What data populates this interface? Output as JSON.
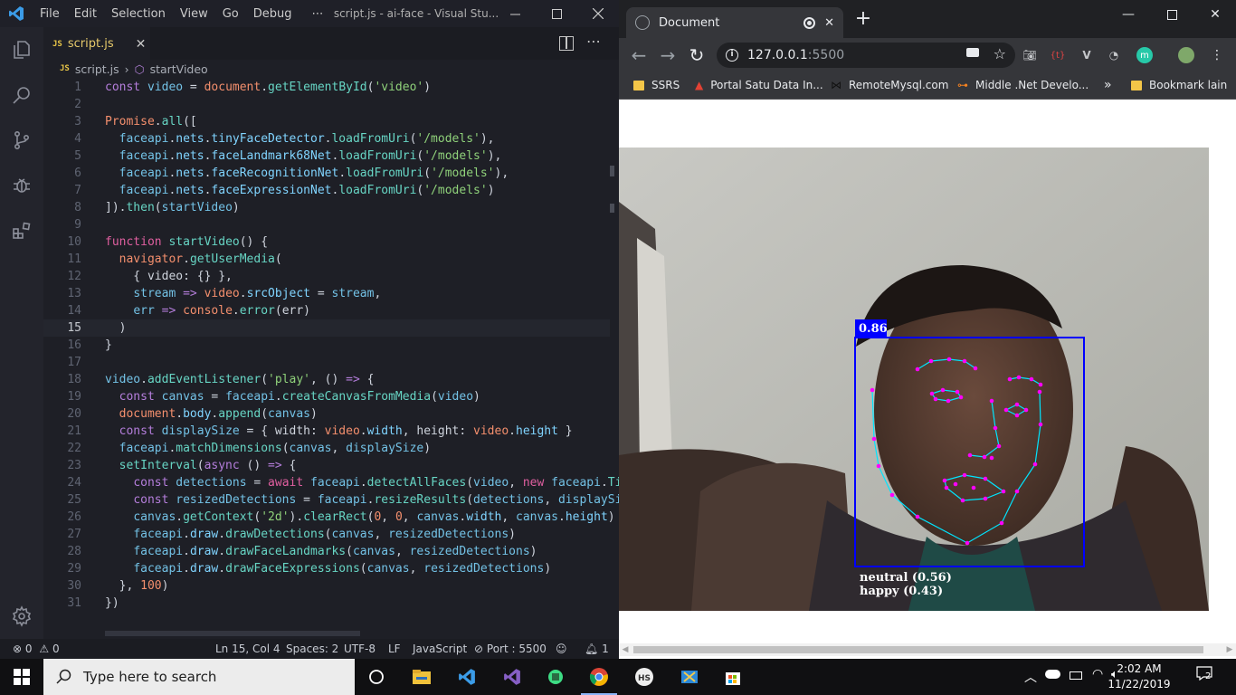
{
  "vscode": {
    "menu": [
      "File",
      "Edit",
      "Selection",
      "View",
      "Go",
      "Debug",
      "⋯"
    ],
    "window_title": "script.js - ai-face - Visual Stu...",
    "tab_label": "script.js",
    "tab_badge": "JS",
    "breadcrumb_file": "script.js",
    "breadcrumb_symbol": "startVideo",
    "current_line": 15,
    "status": {
      "problems_errors": "0",
      "problems_warnings": "0",
      "position": "Ln 15, Col 4",
      "spaces": "Spaces: 2",
      "encoding": "UTF-8",
      "eol": "LF",
      "language": "JavaScript",
      "port": "Port : 5500",
      "notifications": "1"
    }
  },
  "code_lines": [
    [
      [
        "kw2",
        "const "
      ],
      [
        "var",
        "video"
      ],
      [
        "txt",
        " = "
      ],
      [
        "lit",
        "document"
      ],
      [
        "txt",
        "."
      ],
      [
        "vfn",
        "getElementById"
      ],
      [
        "txt",
        "("
      ],
      [
        "str",
        "'video'"
      ],
      [
        "txt",
        ")"
      ]
    ],
    [],
    [
      [
        "lit",
        "Promise"
      ],
      [
        "txt",
        "."
      ],
      [
        "vfn",
        "all"
      ],
      [
        "txt",
        "(["
      ]
    ],
    [
      [
        "txt",
        "  "
      ],
      [
        "var",
        "faceapi"
      ],
      [
        "txt",
        "."
      ],
      [
        "prop",
        "nets"
      ],
      [
        "txt",
        "."
      ],
      [
        "prop",
        "tinyFaceDetector"
      ],
      [
        "txt",
        "."
      ],
      [
        "vfn",
        "loadFromUri"
      ],
      [
        "txt",
        "("
      ],
      [
        "str",
        "'/models'"
      ],
      [
        "txt",
        "),"
      ]
    ],
    [
      [
        "txt",
        "  "
      ],
      [
        "var",
        "faceapi"
      ],
      [
        "txt",
        "."
      ],
      [
        "prop",
        "nets"
      ],
      [
        "txt",
        "."
      ],
      [
        "prop",
        "faceLandmark68Net"
      ],
      [
        "txt",
        "."
      ],
      [
        "vfn",
        "loadFromUri"
      ],
      [
        "txt",
        "("
      ],
      [
        "str",
        "'/models'"
      ],
      [
        "txt",
        "),"
      ]
    ],
    [
      [
        "txt",
        "  "
      ],
      [
        "var",
        "faceapi"
      ],
      [
        "txt",
        "."
      ],
      [
        "prop",
        "nets"
      ],
      [
        "txt",
        "."
      ],
      [
        "prop",
        "faceRecognitionNet"
      ],
      [
        "txt",
        "."
      ],
      [
        "vfn",
        "loadFromUri"
      ],
      [
        "txt",
        "("
      ],
      [
        "str",
        "'/models'"
      ],
      [
        "txt",
        "),"
      ]
    ],
    [
      [
        "txt",
        "  "
      ],
      [
        "var",
        "faceapi"
      ],
      [
        "txt",
        "."
      ],
      [
        "prop",
        "nets"
      ],
      [
        "txt",
        "."
      ],
      [
        "prop",
        "faceExpressionNet"
      ],
      [
        "txt",
        "."
      ],
      [
        "vfn",
        "loadFromUri"
      ],
      [
        "txt",
        "("
      ],
      [
        "str",
        "'/models'"
      ],
      [
        "txt",
        ")"
      ]
    ],
    [
      [
        "txt",
        "])."
      ],
      [
        "vfn",
        "then"
      ],
      [
        "txt",
        "("
      ],
      [
        "var",
        "startVideo"
      ],
      [
        "txt",
        ")"
      ]
    ],
    [],
    [
      [
        "kw",
        "function "
      ],
      [
        "vfn",
        "startVideo"
      ],
      [
        "txt",
        "() {"
      ]
    ],
    [
      [
        "txt",
        "  "
      ],
      [
        "lit",
        "navigator"
      ],
      [
        "txt",
        "."
      ],
      [
        "vfn",
        "getUserMedia"
      ],
      [
        "txt",
        "("
      ]
    ],
    [
      [
        "txt",
        "    { video: {} },"
      ]
    ],
    [
      [
        "txt",
        "    "
      ],
      [
        "var",
        "stream"
      ],
      [
        "txt",
        " "
      ],
      [
        "kw2",
        "=>"
      ],
      [
        "txt",
        " "
      ],
      [
        "lit",
        "video"
      ],
      [
        "txt",
        "."
      ],
      [
        "prop",
        "srcObject"
      ],
      [
        "txt",
        " = "
      ],
      [
        "var",
        "stream"
      ],
      [
        "txt",
        ","
      ]
    ],
    [
      [
        "txt",
        "    "
      ],
      [
        "var",
        "err"
      ],
      [
        "txt",
        " "
      ],
      [
        "kw2",
        "=>"
      ],
      [
        "txt",
        " "
      ],
      [
        "lit",
        "console"
      ],
      [
        "txt",
        "."
      ],
      [
        "vfn",
        "error"
      ],
      [
        "txt",
        "(err)"
      ]
    ],
    [
      [
        "txt",
        "  )"
      ]
    ],
    [
      [
        "txt",
        "}"
      ]
    ],
    [],
    [
      [
        "var",
        "video"
      ],
      [
        "txt",
        "."
      ],
      [
        "vfn",
        "addEventListener"
      ],
      [
        "txt",
        "("
      ],
      [
        "str",
        "'play'"
      ],
      [
        "txt",
        ", () "
      ],
      [
        "kw2",
        "=>"
      ],
      [
        "txt",
        " {"
      ]
    ],
    [
      [
        "txt",
        "  "
      ],
      [
        "kw2",
        "const "
      ],
      [
        "var",
        "canvas"
      ],
      [
        "txt",
        " = "
      ],
      [
        "var",
        "faceapi"
      ],
      [
        "txt",
        "."
      ],
      [
        "vfn",
        "createCanvasFromMedia"
      ],
      [
        "txt",
        "("
      ],
      [
        "var",
        "video"
      ],
      [
        "txt",
        ")"
      ]
    ],
    [
      [
        "txt",
        "  "
      ],
      [
        "lit",
        "document"
      ],
      [
        "txt",
        "."
      ],
      [
        "prop",
        "body"
      ],
      [
        "txt",
        "."
      ],
      [
        "vfn",
        "append"
      ],
      [
        "txt",
        "("
      ],
      [
        "var",
        "canvas"
      ],
      [
        "txt",
        ")"
      ]
    ],
    [
      [
        "txt",
        "  "
      ],
      [
        "kw2",
        "const "
      ],
      [
        "var",
        "displaySize"
      ],
      [
        "txt",
        " = { width: "
      ],
      [
        "lit",
        "video"
      ],
      [
        "txt",
        "."
      ],
      [
        "prop",
        "width"
      ],
      [
        "txt",
        ", height: "
      ],
      [
        "lit",
        "video"
      ],
      [
        "txt",
        "."
      ],
      [
        "prop",
        "height"
      ],
      [
        "txt",
        " }"
      ]
    ],
    [
      [
        "txt",
        "  "
      ],
      [
        "var",
        "faceapi"
      ],
      [
        "txt",
        "."
      ],
      [
        "vfn",
        "matchDimensions"
      ],
      [
        "txt",
        "("
      ],
      [
        "var",
        "canvas"
      ],
      [
        "txt",
        ", "
      ],
      [
        "var",
        "displaySize"
      ],
      [
        "txt",
        ")"
      ]
    ],
    [
      [
        "txt",
        "  "
      ],
      [
        "vfn",
        "setInterval"
      ],
      [
        "txt",
        "("
      ],
      [
        "kw2",
        "async"
      ],
      [
        "txt",
        " () "
      ],
      [
        "kw2",
        "=>"
      ],
      [
        "txt",
        " {"
      ]
    ],
    [
      [
        "txt",
        "    "
      ],
      [
        "kw2",
        "const "
      ],
      [
        "var",
        "detections"
      ],
      [
        "txt",
        " = "
      ],
      [
        "kw",
        "await "
      ],
      [
        "var",
        "faceapi"
      ],
      [
        "txt",
        "."
      ],
      [
        "vfn",
        "detectAllFaces"
      ],
      [
        "txt",
        "("
      ],
      [
        "var",
        "video"
      ],
      [
        "txt",
        ", "
      ],
      [
        "kw",
        "new "
      ],
      [
        "var",
        "faceapi"
      ],
      [
        "txt",
        "."
      ],
      [
        "vfn",
        "Tir"
      ]
    ],
    [
      [
        "txt",
        "    "
      ],
      [
        "kw2",
        "const "
      ],
      [
        "var",
        "resizedDetections"
      ],
      [
        "txt",
        " = "
      ],
      [
        "var",
        "faceapi"
      ],
      [
        "txt",
        "."
      ],
      [
        "vfn",
        "resizeResults"
      ],
      [
        "txt",
        "("
      ],
      [
        "var",
        "detections"
      ],
      [
        "txt",
        ", "
      ],
      [
        "var",
        "displaySiz"
      ]
    ],
    [
      [
        "txt",
        "    "
      ],
      [
        "var",
        "canvas"
      ],
      [
        "txt",
        "."
      ],
      [
        "vfn",
        "getContext"
      ],
      [
        "txt",
        "("
      ],
      [
        "str",
        "'2d'"
      ],
      [
        "txt",
        ")."
      ],
      [
        "vfn",
        "clearRect"
      ],
      [
        "txt",
        "("
      ],
      [
        "lit",
        "0"
      ],
      [
        "txt",
        ", "
      ],
      [
        "lit",
        "0"
      ],
      [
        "txt",
        ", "
      ],
      [
        "var",
        "canvas"
      ],
      [
        "txt",
        "."
      ],
      [
        "prop",
        "width"
      ],
      [
        "txt",
        ", "
      ],
      [
        "var",
        "canvas"
      ],
      [
        "txt",
        "."
      ],
      [
        "prop",
        "height"
      ],
      [
        "txt",
        ")"
      ]
    ],
    [
      [
        "txt",
        "    "
      ],
      [
        "var",
        "faceapi"
      ],
      [
        "txt",
        "."
      ],
      [
        "prop",
        "draw"
      ],
      [
        "txt",
        "."
      ],
      [
        "vfn",
        "drawDetections"
      ],
      [
        "txt",
        "("
      ],
      [
        "var",
        "canvas"
      ],
      [
        "txt",
        ", "
      ],
      [
        "var",
        "resizedDetections"
      ],
      [
        "txt",
        ")"
      ]
    ],
    [
      [
        "txt",
        "    "
      ],
      [
        "var",
        "faceapi"
      ],
      [
        "txt",
        "."
      ],
      [
        "prop",
        "draw"
      ],
      [
        "txt",
        "."
      ],
      [
        "vfn",
        "drawFaceLandmarks"
      ],
      [
        "txt",
        "("
      ],
      [
        "var",
        "canvas"
      ],
      [
        "txt",
        ", "
      ],
      [
        "var",
        "resizedDetections"
      ],
      [
        "txt",
        ")"
      ]
    ],
    [
      [
        "txt",
        "    "
      ],
      [
        "var",
        "faceapi"
      ],
      [
        "txt",
        "."
      ],
      [
        "prop",
        "draw"
      ],
      [
        "txt",
        "."
      ],
      [
        "vfn",
        "drawFaceExpressions"
      ],
      [
        "txt",
        "("
      ],
      [
        "var",
        "canvas"
      ],
      [
        "txt",
        ", "
      ],
      [
        "var",
        "resizedDetections"
      ],
      [
        "txt",
        ")"
      ]
    ],
    [
      [
        "txt",
        "  }, "
      ],
      [
        "lit",
        "100"
      ],
      [
        "txt",
        ")"
      ]
    ],
    [
      [
        "txt",
        "})"
      ]
    ]
  ],
  "chrome": {
    "tab_title": "Document",
    "url_host": "127.0.0.1",
    "url_port": ":5500",
    "bookmarks": [
      "SSRS",
      "Portal Satu Data In...",
      "RemoteMysql.com",
      "Middle .Net Develo..."
    ],
    "overflow_chevron": "»",
    "other_bookmarks": "Bookmark lain",
    "detection_score": "0.86",
    "expressions": [
      "neutral (0.56)",
      "happy (0.43)"
    ]
  },
  "taskbar": {
    "search_placeholder": "Type here to search",
    "time": "2:02 AM",
    "date": "11/22/2019",
    "notification_count": "2"
  },
  "colors": {
    "vscode_bg": "#1e1f26",
    "keyword": "#e05fa0",
    "string": "#8fd17a",
    "detection_box": "#0000ff",
    "landmarks_line": "#00e5ff",
    "landmarks_point": "#ff00ff",
    "chrome_dark": "#35363a"
  }
}
